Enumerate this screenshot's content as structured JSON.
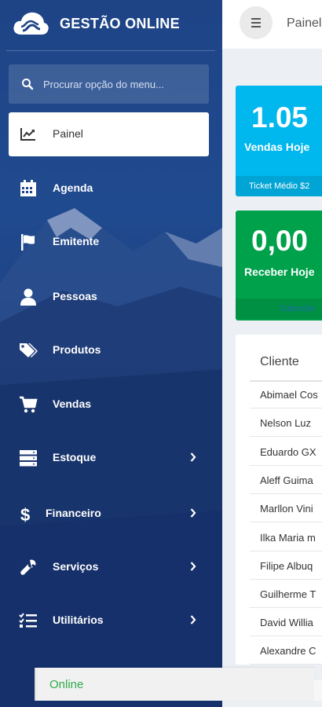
{
  "brand": {
    "name": "GESTÃO ONLINE",
    "logo": "cloud-logo"
  },
  "search": {
    "placeholder": "Procurar opção do menu..."
  },
  "sidebar": {
    "items": [
      {
        "label": "Painel",
        "icon": "chart-line-icon",
        "active": true,
        "has_submenu": false
      },
      {
        "label": "Agenda",
        "icon": "calendar-icon",
        "active": false,
        "has_submenu": false
      },
      {
        "label": "Emitente",
        "icon": "flag-icon",
        "active": false,
        "has_submenu": false
      },
      {
        "label": "Pessoas",
        "icon": "user-icon",
        "active": false,
        "has_submenu": false
      },
      {
        "label": "Produtos",
        "icon": "tags-icon",
        "active": false,
        "has_submenu": false
      },
      {
        "label": "Vendas",
        "icon": "cart-icon",
        "active": false,
        "has_submenu": false
      },
      {
        "label": "Estoque",
        "icon": "server-icon",
        "active": false,
        "has_submenu": true
      },
      {
        "label": "Financeiro",
        "icon": "dollar-icon",
        "active": false,
        "has_submenu": true
      },
      {
        "label": "Serviços",
        "icon": "wrench-icon",
        "active": false,
        "has_submenu": true
      },
      {
        "label": "Utilitários",
        "icon": "tasks-icon",
        "active": false,
        "has_submenu": true
      }
    ]
  },
  "header": {
    "title": "Painel"
  },
  "cards": {
    "sales": {
      "value": "1.05",
      "label": "Vendas Hoje",
      "footer": "Ticket Médio $2",
      "color": "#00b7ee"
    },
    "receivable": {
      "value": "0,00",
      "label": "Receber Hoje",
      "footer": "Calendár",
      "color": "#00a14b"
    }
  },
  "table": {
    "header": "Cliente",
    "rows": [
      "Abimael Cos",
      "Nelson Luz",
      "Eduardo GX",
      "Aleff Guima",
      "Marllon Vini",
      "Ilka Maria m",
      "Filipe Albuq",
      "Guilherme T",
      "David Willia",
      "Alexandre C"
    ]
  },
  "status": {
    "text": "Online"
  },
  "colors": {
    "sidebar": "#1e4486",
    "accent_blue": "#00b7ee",
    "accent_green": "#00a14b",
    "online": "#2eaa4a"
  }
}
